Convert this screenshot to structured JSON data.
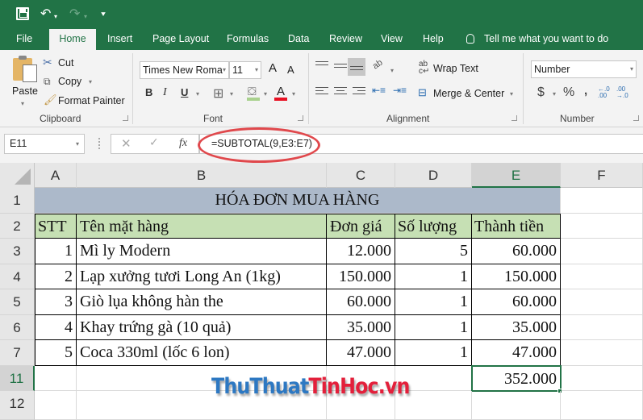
{
  "qat": {
    "save_icon": "save-icon",
    "undo_icon": "↶",
    "redo_icon": "↷",
    "dropdown_glyph": "▾",
    "customize_glyph": "⯆"
  },
  "tabs": [
    {
      "label": "File",
      "active": false
    },
    {
      "label": "Home",
      "active": true
    },
    {
      "label": "Insert",
      "active": false
    },
    {
      "label": "Page Layout",
      "active": false
    },
    {
      "label": "Formulas",
      "active": false
    },
    {
      "label": "Data",
      "active": false
    },
    {
      "label": "Review",
      "active": false
    },
    {
      "label": "View",
      "active": false
    },
    {
      "label": "Help",
      "active": false
    }
  ],
  "tell_me": "Tell me what you want to do",
  "ribbon": {
    "clipboard": {
      "label": "Clipboard",
      "paste": "Paste",
      "cut": "Cut",
      "copy": "Copy",
      "format_painter": "Format Painter"
    },
    "font": {
      "label": "Font",
      "font_name": "Times New Roma",
      "font_size": "11",
      "bold": "B",
      "italic": "I",
      "underline": "U",
      "grow": "A",
      "shrink": "A",
      "font_color_glyph": "A",
      "fill_color_accent": "#a9d18e",
      "font_color_accent": "#e81123"
    },
    "alignment": {
      "label": "Alignment",
      "wrap_text": "Wrap Text",
      "merge_center": "Merge & Center"
    },
    "number": {
      "label": "Number",
      "format": "Number",
      "currency": "$",
      "percent": "%",
      "comma": ",",
      "inc_decimal": "←.0 .00",
      "dec_decimal": ".00 →.0"
    }
  },
  "formula_bar": {
    "name_box": "E11",
    "cancel_glyph": "✕",
    "enter_glyph": "✓",
    "fx": "fx",
    "formula": "=SUBTOTAL(9,E3:E7)"
  },
  "sheet": {
    "columns": [
      "A",
      "B",
      "C",
      "D",
      "E",
      "F"
    ],
    "selected_column": "E",
    "row_numbers": [
      "1",
      "2",
      "3",
      "4",
      "5",
      "6",
      "7",
      "11",
      "12"
    ],
    "selected_row": "11",
    "title": "HÓA ĐƠN MUA HÀNG",
    "headers": [
      "STT",
      "Tên mặt hàng",
      "Đơn giá",
      "Số lượng",
      "Thành tiền"
    ],
    "rows": [
      {
        "stt": "1",
        "name": "Mì ly Modern",
        "price": "12.000",
        "qty": "5",
        "total": "60.000"
      },
      {
        "stt": "2",
        "name": "Lạp xưởng tươi Long An (1kg)",
        "price": "150.000",
        "qty": "1",
        "total": "150.000"
      },
      {
        "stt": "3",
        "name": "Giò lụa không hàn the",
        "price": "60.000",
        "qty": "1",
        "total": "60.000"
      },
      {
        "stt": "4",
        "name": "Khay trứng gà (10 quả)",
        "price": "35.000",
        "qty": "1",
        "total": "35.000"
      },
      {
        "stt": "5",
        "name": "Coca 330ml (lốc 6 lon)",
        "price": "47.000",
        "qty": "1",
        "total": "47.000"
      }
    ],
    "subtotal": "352.000",
    "colors": {
      "title_fill": "#acb9ca",
      "header_fill": "#c6e0b4",
      "selection": "#217346"
    }
  },
  "watermark": {
    "part1": "ThuThuat",
    "part2": "TinHoc.vn"
  },
  "theme": {
    "excel_green": "#217346",
    "annotation_red": "#e0484c"
  }
}
